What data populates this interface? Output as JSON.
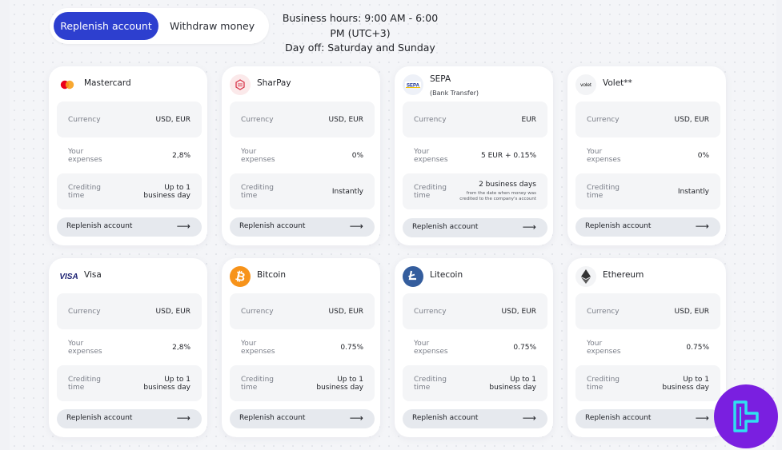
{
  "tabs": {
    "active": "Replenish account",
    "second": "Withdraw money"
  },
  "hours": {
    "line1": "Business hours: 9:00 AM - 6:00 PM (UTC+3)",
    "line2": "Day off: Saturday and Sunday"
  },
  "labels": {
    "currency": "Currency",
    "expenses": "Your expenses",
    "crediting": "Crediting time",
    "button": "Replenish account"
  },
  "arrow": "⟶",
  "cards": [
    {
      "name": "Mastercard",
      "icon": "mastercard-logo-icon",
      "currency": "USD, EUR",
      "expenses": "2,8%",
      "crediting": "Up to 1 business day"
    },
    {
      "name": "SharPay",
      "icon": "sharpay-logo-icon",
      "currency": "USD, EUR",
      "expenses": "0%",
      "crediting": "Instantly"
    },
    {
      "name": "SEPA",
      "subtitle": "(Bank Transfer)",
      "icon": "sepa-logo-icon",
      "currency": "EUR",
      "expenses": "5 EUR + 0.15%",
      "crediting": "2 business days",
      "crediting_note": "from the date when money was credited to the company's account"
    },
    {
      "name": "Volet**",
      "icon": "volet-logo-icon",
      "logo_text": "volet",
      "currency": "USD, EUR",
      "expenses": "0%",
      "crediting": "Instantly"
    },
    {
      "name": "Visa",
      "icon": "visa-logo-icon",
      "logo_text": "VISA",
      "currency": "USD, EUR",
      "expenses": "2,8%",
      "crediting": "Up to 1 business day"
    },
    {
      "name": "Bitcoin",
      "icon": "bitcoin-logo-icon",
      "currency": "USD, EUR",
      "expenses": "0.75%",
      "crediting": "Up to 1 business day"
    },
    {
      "name": "Litecoin",
      "icon": "litecoin-logo-icon",
      "currency": "USD, EUR",
      "expenses": "0.75%",
      "crediting": "Up to 1 business day"
    },
    {
      "name": "Ethereum",
      "icon": "ethereum-logo-icon",
      "currency": "USD, EUR",
      "expenses": "0.75%",
      "crediting": "Up to 1 business day"
    }
  ],
  "colors": {
    "accent": "#2d3fcf",
    "brand_badge": "#7a1fe0",
    "bitcoin": "#f7931a",
    "litecoin": "#345d9d"
  }
}
